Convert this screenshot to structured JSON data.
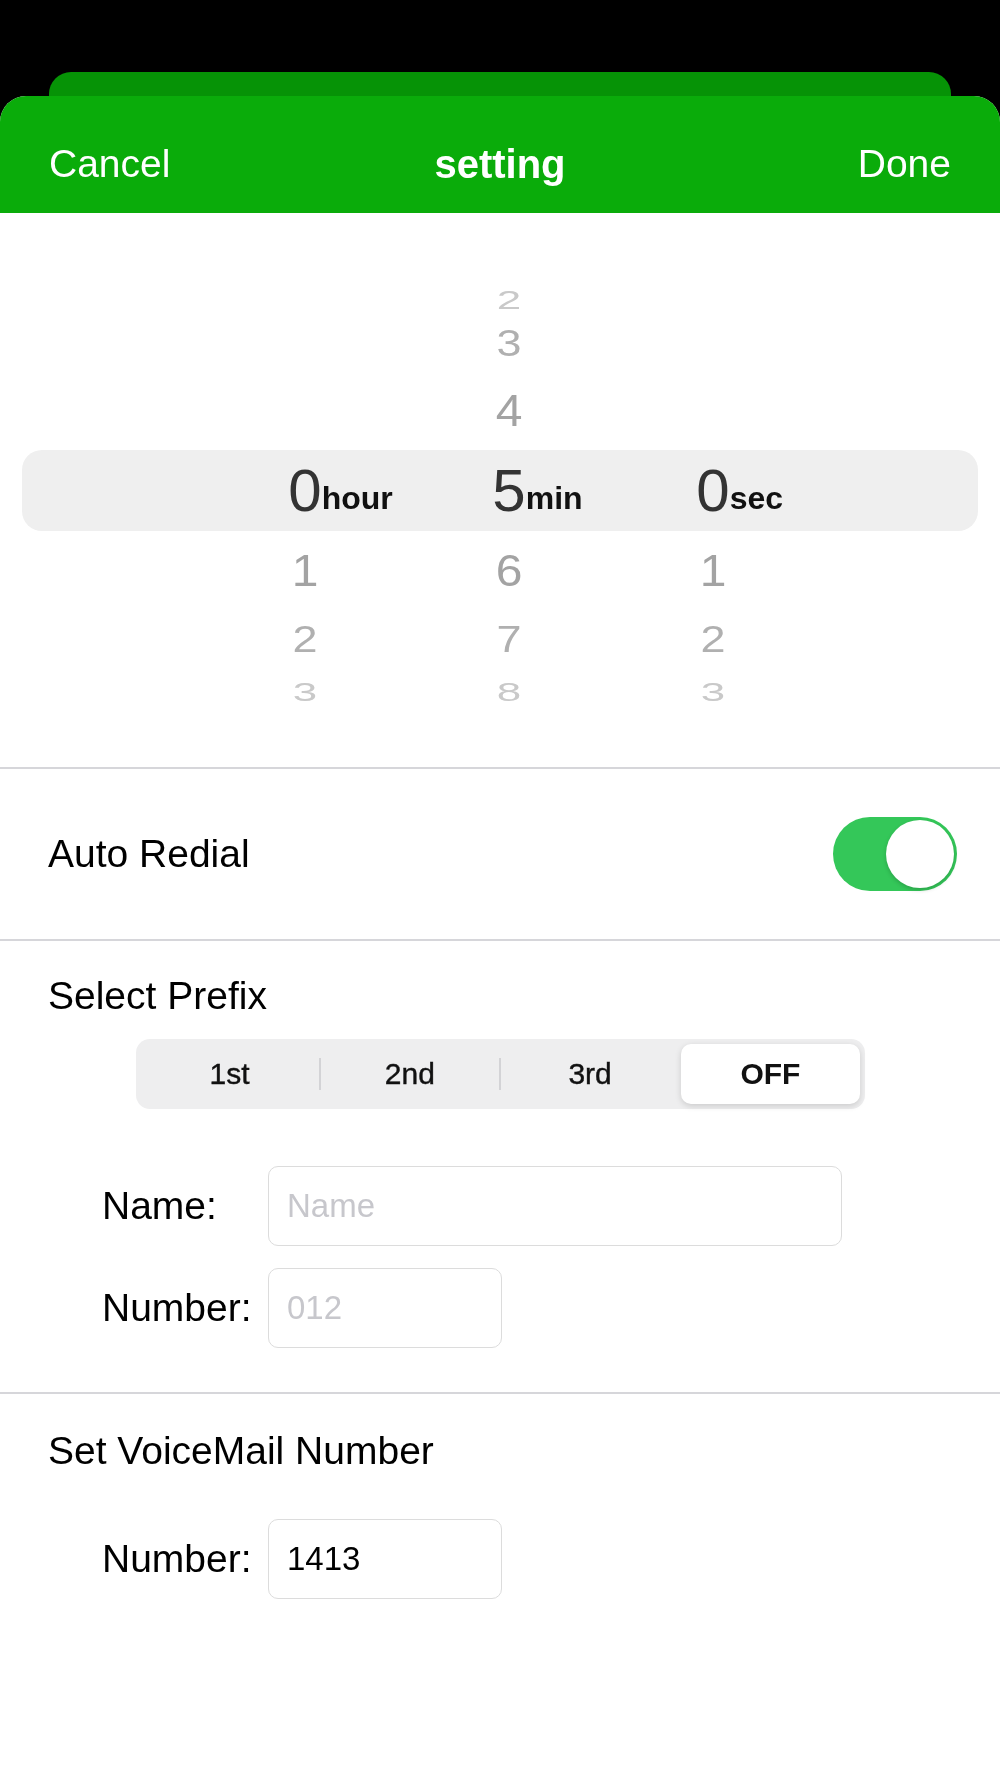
{
  "nav_bar": {
    "cancel": "Cancel",
    "title": "setting",
    "done": "Done"
  },
  "timer_picker": {
    "columns": [
      {
        "unit_label": "hour",
        "items": [
          {
            "value": "0",
            "selected": true
          },
          {
            "value": "1",
            "selected": false
          },
          {
            "value": "2",
            "selected": false
          },
          {
            "value": "3",
            "selected": false
          }
        ]
      },
      {
        "unit_label": "min",
        "items": [
          {
            "value": "2",
            "selected": false
          },
          {
            "value": "3",
            "selected": false
          },
          {
            "value": "4",
            "selected": false
          },
          {
            "value": "5",
            "selected": true
          },
          {
            "value": "6",
            "selected": false
          },
          {
            "value": "7",
            "selected": false
          },
          {
            "value": "8",
            "selected": false
          }
        ]
      },
      {
        "unit_label": "sec",
        "items": [
          {
            "value": "0",
            "selected": true
          },
          {
            "value": "1",
            "selected": false
          },
          {
            "value": "2",
            "selected": false
          },
          {
            "value": "3",
            "selected": false
          }
        ]
      }
    ]
  },
  "auto_redial": {
    "label": "Auto Redial",
    "on": true
  },
  "prefix": {
    "title": "Select Prefix",
    "segments": [
      {
        "label": "1st",
        "selected": false
      },
      {
        "label": "2nd",
        "selected": false
      },
      {
        "label": "3rd",
        "selected": false
      },
      {
        "label": "OFF",
        "selected": true
      }
    ],
    "fields": [
      {
        "kind": "text",
        "label": "Name:",
        "placeholder": "Name"
      },
      {
        "kind": "number",
        "label": "Number:",
        "placeholder": "012"
      }
    ]
  },
  "voicemail": {
    "title": "Set VoiceMail Number",
    "fields": [
      {
        "kind": "number",
        "label": "Number:",
        "value": "1413"
      }
    ]
  }
}
